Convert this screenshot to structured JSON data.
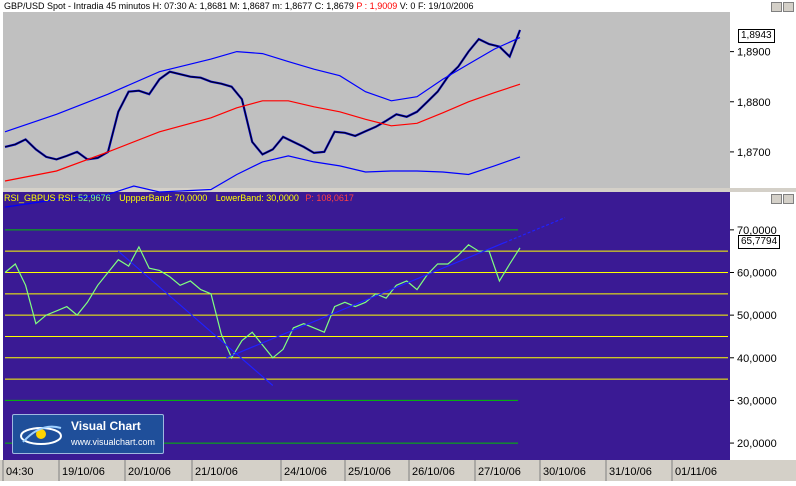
{
  "price_header": {
    "symbol": "GBP/USD Spot",
    "timeframe": "Intradia 45 minutos",
    "H": "H: 07:30",
    "A": "A: 1,8681",
    "M": "M: 1,8687",
    "m": "m: 1,8677",
    "C": "C: 1,8679",
    "P": "P : 1,9009",
    "V": "V: 0",
    "F": "F: 19/10/2006"
  },
  "rsi_header": {
    "name": "RSI_GBPUS RSI:",
    "rsi_value": "52,9676",
    "upper_label": "UppperBand:",
    "upper_value": "70,0000",
    "lower_label": "LowerBand:",
    "lower_value": "30,0000",
    "p": "P: 108,0617"
  },
  "badges": {
    "price_last": "1,8943",
    "rsi_last": "65,7794"
  },
  "logo": {
    "title": "Visual Chart",
    "url": "www.visualchart.com"
  },
  "colors": {
    "price_bg": "#c0c0c0",
    "rsi_bg": "#3a1a94",
    "price_line": "#000000",
    "price_bars": "#0000c0",
    "bollinger": "#0000ff",
    "ma": "#ff0000",
    "rsi_line": "#80ff80",
    "level_yellow": "#ffff00",
    "level_green": "#00c000",
    "trend": "#2020ff"
  },
  "chart_data": [
    {
      "type": "line",
      "title": "GBP/USD Spot - Intradia 45 minutos",
      "yticks": [
        1.87,
        1.88,
        1.89
      ],
      "ytick_labels": [
        "1,8700",
        "1,8800",
        "1,8900"
      ],
      "ylim": [
        1.8632,
        1.8975
      ],
      "xlim": [
        0,
        100
      ],
      "series": [
        {
          "name": "GBP/USD Spot",
          "x": [
            0,
            2,
            4,
            6,
            8,
            10,
            12,
            14,
            16,
            18,
            20,
            22,
            24,
            26,
            28,
            30,
            32,
            34,
            36,
            38,
            40,
            42,
            44,
            46,
            48,
            50,
            52,
            54,
            56,
            58,
            60,
            62,
            64,
            66,
            68,
            70,
            72,
            74,
            76,
            78,
            80,
            82,
            84,
            86,
            88,
            90,
            92,
            94,
            96,
            98,
            100
          ],
          "values": [
            1.871,
            1.8715,
            1.8725,
            1.8705,
            1.869,
            1.8685,
            1.8692,
            1.87,
            1.8685,
            1.8688,
            1.87,
            1.878,
            1.882,
            1.8822,
            1.8815,
            1.8845,
            1.886,
            1.8855,
            1.885,
            1.8848,
            1.884,
            1.8836,
            1.883,
            1.8805,
            1.872,
            1.8695,
            1.8705,
            1.873,
            1.872,
            1.871,
            1.8698,
            1.87,
            1.874,
            1.8738,
            1.8732,
            1.8741,
            1.875,
            1.8762,
            1.8775,
            1.877,
            1.878,
            1.88,
            1.882,
            1.885,
            1.887,
            1.89,
            1.8925,
            1.8915,
            1.891,
            1.889,
            1.8943
          ]
        },
        {
          "name": "Upper Band",
          "x": [
            0,
            10,
            20,
            30,
            40,
            45,
            50,
            55,
            60,
            65,
            70,
            75,
            80,
            85,
            90,
            95,
            100
          ],
          "values": [
            1.874,
            1.8775,
            1.8815,
            1.886,
            1.8885,
            1.89,
            1.8896,
            1.888,
            1.8865,
            1.8852,
            1.882,
            1.8802,
            1.881,
            1.8845,
            1.8875,
            1.8905,
            1.8928
          ]
        },
        {
          "name": "Moving Average",
          "x": [
            0,
            10,
            20,
            30,
            40,
            45,
            50,
            55,
            60,
            65,
            70,
            75,
            80,
            85,
            90,
            95,
            100
          ],
          "values": [
            1.8642,
            1.8662,
            1.87,
            1.874,
            1.8768,
            1.8788,
            1.8802,
            1.8802,
            1.879,
            1.878,
            1.8765,
            1.8752,
            1.8757,
            1.8778,
            1.88,
            1.8818,
            1.8835
          ]
        },
        {
          "name": "Lower Band",
          "x": [
            0,
            10,
            20,
            25,
            30,
            40,
            45,
            50,
            55,
            60,
            65,
            70,
            75,
            80,
            85,
            90,
            95,
            100
          ],
          "values": [
            1.859,
            1.8605,
            1.8615,
            1.8632,
            1.862,
            1.8625,
            1.8655,
            1.868,
            1.8692,
            1.868,
            1.8672,
            1.866,
            1.8662,
            1.8662,
            1.866,
            1.8655,
            1.8672,
            1.869
          ]
        }
      ]
    },
    {
      "type": "line",
      "title": "RSI_GBPUS",
      "yticks": [
        20,
        30,
        40,
        50,
        60,
        70
      ],
      "ytick_labels": [
        "20,0000",
        "30,0000",
        "40,0000",
        "50,0000",
        "60,0000",
        "70,0000"
      ],
      "ylim": [
        16.5,
        77.0
      ],
      "xlim": [
        0,
        100
      ],
      "levels_yellow": [
        35,
        40,
        45,
        50,
        55,
        60,
        65
      ],
      "levels_green": [
        20,
        30,
        70
      ],
      "x_labels": [
        "04:30",
        "19/10/06",
        "20/10/06",
        "21/10/06",
        "24/10/06",
        "25/10/06",
        "26/10/06",
        "27/10/06",
        "30/10/06",
        "31/10/06",
        "01/11/06"
      ],
      "series": [
        {
          "name": "RSI",
          "x": [
            0,
            2,
            4,
            6,
            8,
            10,
            12,
            14,
            16,
            18,
            20,
            22,
            24,
            26,
            28,
            30,
            32,
            34,
            36,
            38,
            40,
            42,
            44,
            46,
            48,
            50,
            52,
            54,
            56,
            58,
            60,
            62,
            64,
            66,
            68,
            70,
            72,
            74,
            76,
            78,
            80,
            82,
            84,
            86,
            88,
            90,
            92,
            94,
            96,
            98,
            100
          ],
          "values": [
            60.0,
            62.0,
            57.0,
            48.0,
            50.0,
            51.0,
            52.0,
            50.0,
            53.0,
            57.0,
            60.0,
            63.0,
            61.5,
            66.0,
            61.0,
            60.5,
            59.0,
            57.0,
            58.0,
            56.0,
            55.0,
            45.5,
            40.0,
            44.0,
            46.0,
            43.0,
            40.0,
            42.0,
            47.0,
            48.0,
            47.0,
            46.0,
            52.0,
            53.0,
            52.0,
            53.0,
            55.0,
            54.0,
            57.0,
            58.0,
            56.0,
            59.5,
            62.0,
            62.0,
            64.0,
            66.5,
            65.0,
            65.0,
            58.0,
            62.0,
            65.7794
          ]
        },
        {
          "name": "Downtrend",
          "x": [
            22,
            52
          ],
          "values": [
            65.0,
            33.5
          ]
        },
        {
          "name": "Uptrend",
          "x": [
            43,
            97
          ],
          "values": [
            40.0,
            67.0
          ]
        }
      ]
    }
  ]
}
